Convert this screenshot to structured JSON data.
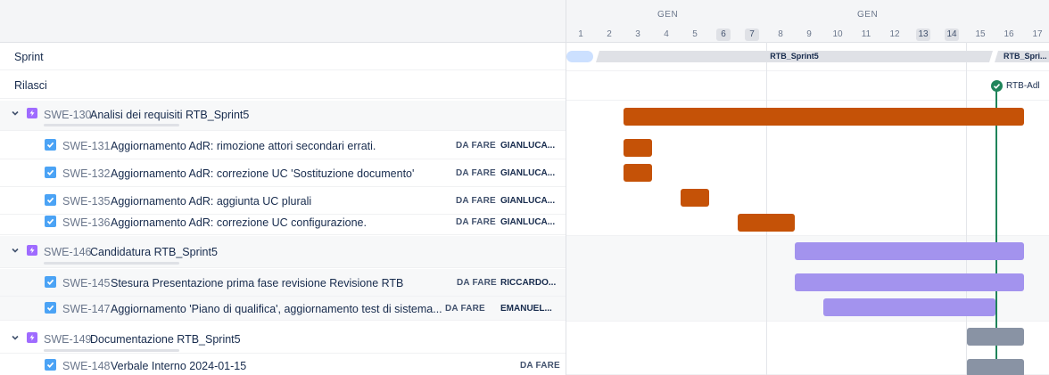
{
  "timeline": {
    "months": [
      "GEN",
      "GEN"
    ],
    "days": [
      "1",
      "2",
      "3",
      "4",
      "5",
      "6",
      "7",
      "8",
      "9",
      "10",
      "11",
      "12",
      "13",
      "14",
      "15",
      "16",
      "17"
    ]
  },
  "rows": {
    "sprint_label": "Sprint",
    "releases_label": "Rilasci"
  },
  "sprints": [
    {
      "name": ""
    },
    {
      "name": "RTB_Sprint5"
    },
    {
      "name": "RTB_Spri..."
    }
  ],
  "release": {
    "name": "RTB-Adl"
  },
  "epics": [
    {
      "key": "SWE-130",
      "summary": "Analisi dei requisiti RTB_Sprint5",
      "tasks": [
        {
          "key": "SWE-131",
          "summary": "Aggiornamento AdR: rimozione attori secondari errati.",
          "status": "DA FARE",
          "assignee": "GIANLUCA..."
        },
        {
          "key": "SWE-132",
          "summary": "Aggiornamento AdR: correzione UC 'Sostituzione documento'",
          "status": "DA FARE",
          "assignee": "GIANLUCA..."
        },
        {
          "key": "SWE-135",
          "summary": "Aggiornamento AdR: aggiunta UC plurali",
          "status": "DA FARE",
          "assignee": "GIANLUCA..."
        },
        {
          "key": "SWE-136",
          "summary": "Aggiornamento AdR: correzione UC configurazione.",
          "status": "DA FARE",
          "assignee": "GIANLUCA..."
        }
      ]
    },
    {
      "key": "SWE-146",
      "summary": "Candidatura RTB_Sprint5",
      "tasks": [
        {
          "key": "SWE-145",
          "summary": "Stesura Presentazione prima fase revisione Revisione RTB",
          "status": "DA FARE",
          "assignee": "RICCARDO..."
        },
        {
          "key": "SWE-147",
          "summary": "Aggiornamento 'Piano di qualifica', aggiornamento test di sistema...",
          "status": "DA FARE",
          "assignee": "EMANUEL..."
        }
      ]
    },
    {
      "key": "SWE-149",
      "summary": "Documentazione RTB_Sprint5",
      "tasks": [
        {
          "key": "SWE-148",
          "summary": "Verbale Interno 2024-01-15",
          "status": "DA FARE",
          "assignee": ""
        }
      ]
    }
  ],
  "colors": {
    "epic1": "#c55207",
    "epic2": "#a393ee",
    "epic3": "#8993a4",
    "release_line": "#1f845a",
    "today_start": "#cce0ff"
  }
}
